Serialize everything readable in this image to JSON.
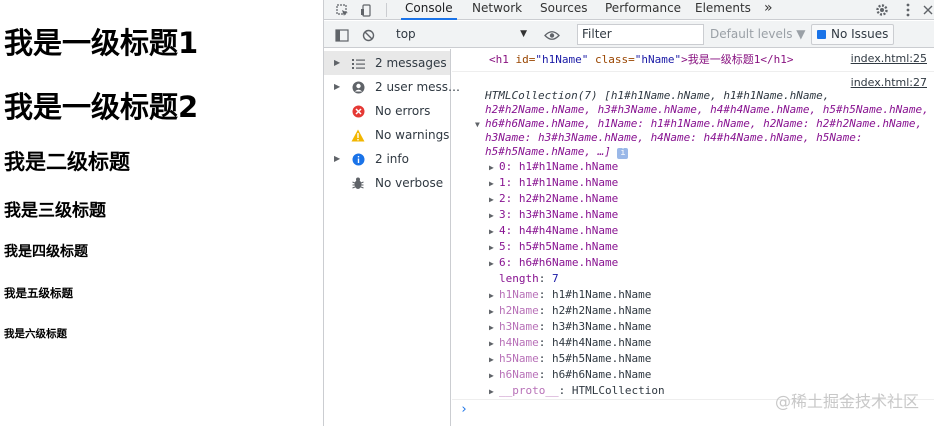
{
  "page": {
    "headings": [
      "我是一级标题1",
      "我是一级标题2",
      "我是二级标题",
      "我是三级标题",
      "我是四级标题",
      "我是五级标题",
      "我是六级标题"
    ]
  },
  "devtools": {
    "tabs": [
      "Console",
      "Network",
      "Sources",
      "Performance",
      "Elements"
    ],
    "more_tabs": "»",
    "context": "top",
    "filter_placeholder": "Filter",
    "levels": "Default levels ▼",
    "issues": "No Issues",
    "sidebar": [
      {
        "label": "2 messages",
        "icon": "list-icon"
      },
      {
        "label": "2 user mess…",
        "icon": "user-icon"
      },
      {
        "label": "No errors",
        "icon": "error-icon"
      },
      {
        "label": "No warnings",
        "icon": "warning-icon"
      },
      {
        "label": "2 info",
        "icon": "info-icon"
      },
      {
        "label": "No verbose",
        "icon": "bug-icon"
      }
    ],
    "console": {
      "src1": "index.html:25",
      "src2": "index.html:27",
      "el_open": "<h1",
      "el_id_attr": "id=",
      "el_id_val": "\"h1Name\"",
      "el_class_attr": "class=",
      "el_class_val": "\"hName\"",
      "el_text": ">我是一级标题1",
      "el_close": "</h1>",
      "coll_l1": "HTMLCollection(7) [h1#h1Name.hName, h1#h1Name.hName,",
      "coll_l2": "h2#h2Name.hName, h3#h3Name.hName, h4#h4Name.hName, h5#h5Name.hName,",
      "coll_l3": "h6#h6Name.hName, h1Name: h1#h1Name.hName, h2Name: h2#h2Name.hName,",
      "coll_l4": "h3Name: h3#h3Name.hName, h4Name: h4#h4Name.hName, h5Name:",
      "coll_l5": "h5#h5Name.hName, …]",
      "items": [
        {
          "key": "0",
          "value": "h1#h1Name.hName"
        },
        {
          "key": "1",
          "value": "h1#h1Name.hName"
        },
        {
          "key": "2",
          "value": "h2#h2Name.hName"
        },
        {
          "key": "3",
          "value": "h3#h3Name.hName"
        },
        {
          "key": "4",
          "value": "h4#h4Name.hName"
        },
        {
          "key": "5",
          "value": "h5#h5Name.hName"
        },
        {
          "key": "6",
          "value": "h6#h6Name.hName"
        }
      ],
      "length_key": "length",
      "length_value": "7",
      "named": [
        {
          "key": "h1Name",
          "value": "h1#h1Name.hName"
        },
        {
          "key": "h2Name",
          "value": "h2#h2Name.hName"
        },
        {
          "key": "h3Name",
          "value": "h3#h3Name.hName"
        },
        {
          "key": "h4Name",
          "value": "h4#h4Name.hName"
        },
        {
          "key": "h5Name",
          "value": "h5#h5Name.hName"
        },
        {
          "key": "h6Name",
          "value": "h6#h6Name.hName"
        }
      ],
      "proto_key": "__proto__",
      "proto_value": "HTMLCollection",
      "prompt": "›"
    },
    "watermark": "@稀土掘金技术社区"
  }
}
